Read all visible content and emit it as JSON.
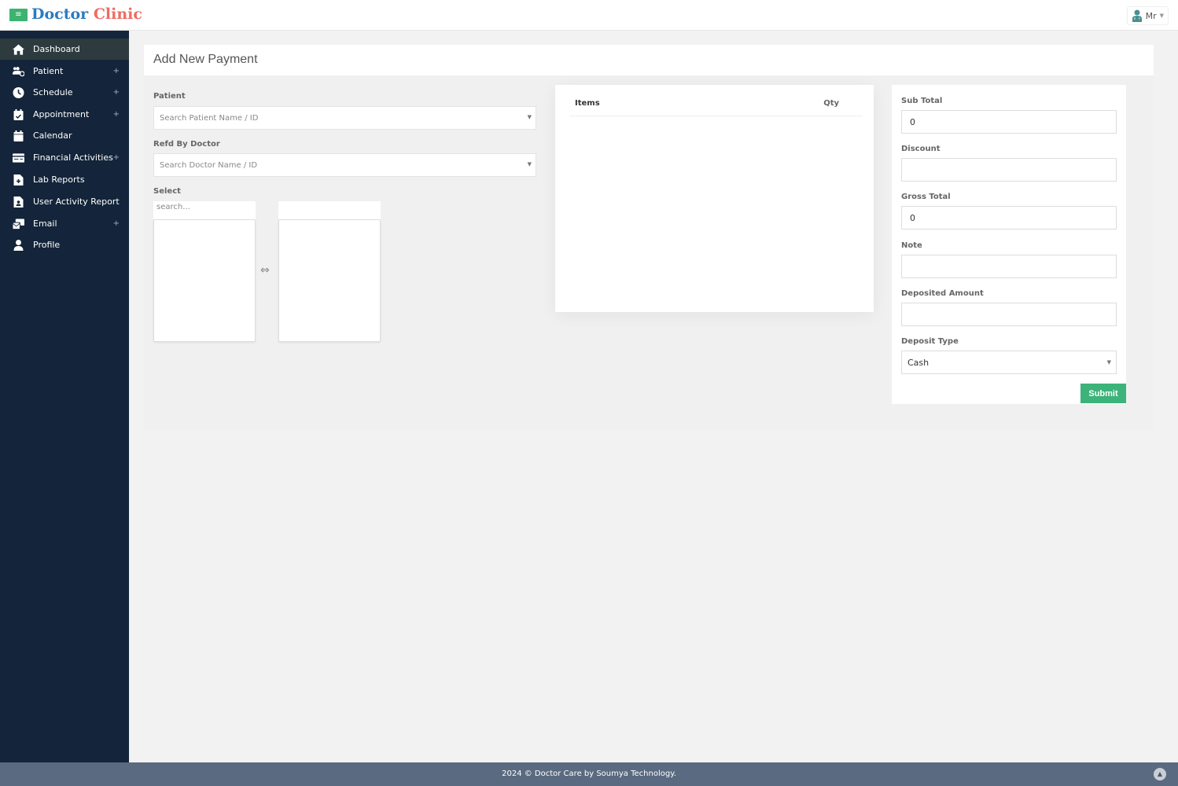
{
  "header": {
    "menu_icon": "hamburger-icon",
    "brand_part1": "Doctor",
    "brand_part2": "Clinic",
    "user": {
      "icon": "doctor-avatar-icon",
      "label": "Mr"
    }
  },
  "sidebar": {
    "items": [
      {
        "label": "Dashboard",
        "icon": "home-icon",
        "active": true,
        "expandable": false
      },
      {
        "label": "Patient",
        "icon": "users-plus-icon",
        "expandable": true
      },
      {
        "label": "Schedule",
        "icon": "clock-icon",
        "expandable": true
      },
      {
        "label": "Appointment",
        "icon": "calendar-check-icon",
        "expandable": true
      },
      {
        "label": "Calendar",
        "icon": "calendar-icon",
        "expandable": false
      },
      {
        "label": "Financial Activities",
        "icon": "money-card-icon",
        "expandable": true
      },
      {
        "label": "Lab Reports",
        "icon": "file-medical-icon",
        "expandable": false
      },
      {
        "label": "User Activity Report",
        "icon": "file-user-icon",
        "expandable": false
      },
      {
        "label": "Email",
        "icon": "envelopes-icon",
        "expandable": true
      },
      {
        "label": "Profile",
        "icon": "user-icon",
        "expandable": false
      }
    ],
    "expand_glyph": "+"
  },
  "page": {
    "title": "Add New Payment",
    "patient": {
      "label": "Patient",
      "placeholder": "Search Patient Name / ID"
    },
    "doctor": {
      "label": "Refd By Doctor",
      "placeholder": "Search Doctor Name / ID"
    },
    "select": {
      "label": "Select",
      "search_placeholder": "search...",
      "swap_glyph": "⇔"
    },
    "items_table": {
      "columns": [
        "Items",
        "Qty"
      ],
      "rows": []
    },
    "totals": {
      "sub_total": {
        "label": "Sub Total",
        "value": "0"
      },
      "discount": {
        "label": "Discount",
        "value": ""
      },
      "gross_total": {
        "label": "Gross Total",
        "value": "0"
      },
      "note": {
        "label": "Note",
        "value": ""
      },
      "deposited_amount": {
        "label": "Deposited Amount",
        "value": ""
      },
      "deposit_type": {
        "label": "Deposit Type",
        "value": "Cash"
      }
    },
    "submit_label": "Submit"
  },
  "footer": {
    "text": "2024 © Doctor Care by Soumya Technology."
  },
  "colors": {
    "brand_blue": "#2b7bbf",
    "brand_red": "#ef6b64",
    "accent_green": "#3cb37a",
    "sidebar_bg": "#14243a",
    "footer_bg": "#5a6a80"
  }
}
